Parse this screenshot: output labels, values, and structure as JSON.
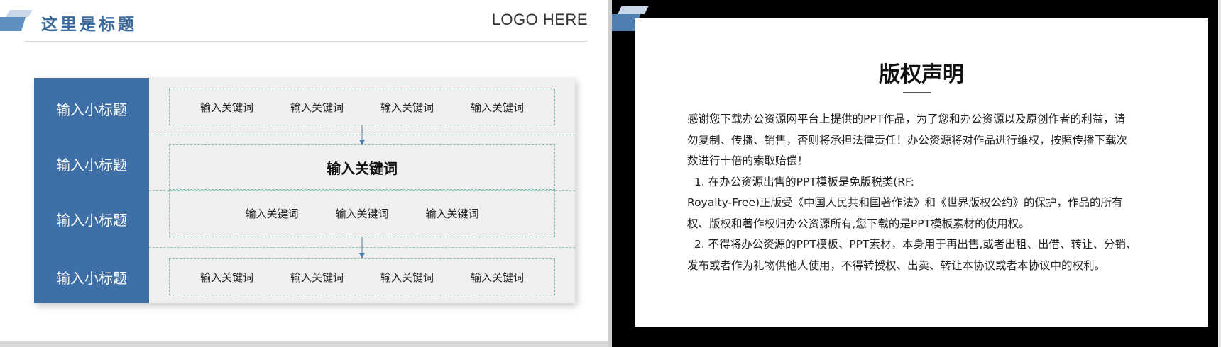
{
  "left_slide": {
    "title": "这里是标题",
    "logo": "LOGO HERE",
    "rows": [
      {
        "label": "输入小标题",
        "keywords": [
          "输入关键词",
          "输入关键词",
          "输入关键词",
          "输入关键词"
        ]
      },
      {
        "label": "输入小标题",
        "keywords": [
          "输入关键词"
        ]
      },
      {
        "label": "输入小标题",
        "keywords": [
          "输入关键词",
          "输入关键词",
          "输入关键词"
        ]
      },
      {
        "label": "输入小标题",
        "keywords": [
          "输入关键词",
          "输入关键词",
          "输入关键词",
          "输入关键词"
        ]
      }
    ]
  },
  "right_slide": {
    "title": "版权声明",
    "lines": [
      "感谢您下载办公资源网平台上提供的PPT作品，为了您和办公资源以及原创作者的利益，请",
      "勿复制、传播、销售，否则将承担法律责任！办公资源将对作品进行维权，按照传播下载次",
      "数进行十倍的索取赔偿！",
      "  1. 在办公资源出售的PPT模板是免版税类(RF:",
      "Royalty-Free)正版受《中国人民共和国著作法》和《世界版权公约》的保护，作品的所有",
      "权、版权和著作权归办公资源所有,您下载的是PPT模板素材的使用权。",
      "  2. 不得将办公资源的PPT模板、PPT素材，本身用于再出售,或者出租、出借、转让、分销、",
      "发布或者作为礼物供他人使用，不得转授权、出卖、转让本协议或者本协议中的权利。"
    ]
  },
  "colors": {
    "accent_blue": "#3e6fa6",
    "title_blue": "#3d6b9c",
    "dashed_teal": "#7fbfb2",
    "panel_gray": "#efefef"
  },
  "icons": [
    "header-parallelogram-icon",
    "arrow-down-icon"
  ]
}
